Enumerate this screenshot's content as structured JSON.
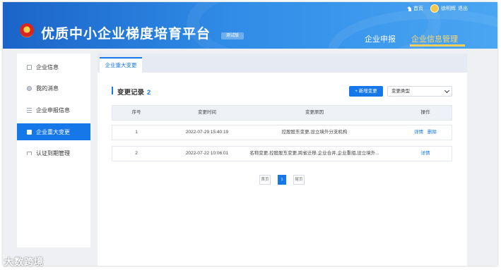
{
  "header": {
    "title": "优质中小企业梯度培育平台",
    "test_tag": "测试版",
    "home_label": "首页",
    "user_name": "徐明辉",
    "logout_label": "退出",
    "nav": [
      "企业申报",
      "企业信息管理"
    ],
    "active_nav": "企业信息管理"
  },
  "sidebar": {
    "items": [
      {
        "label": "企业信息",
        "icon": "document-icon"
      },
      {
        "label": "我的消息",
        "icon": "message-icon"
      },
      {
        "label": "企业申报信息",
        "icon": "list-icon"
      },
      {
        "label": "企业重大变更",
        "icon": "change-icon",
        "active": true
      },
      {
        "label": "认证到期管理",
        "icon": "flag-icon"
      }
    ]
  },
  "main": {
    "tab": "企业重大变更",
    "record_label": "变更记录",
    "record_count": "2",
    "add_button": "+ 新增变更",
    "select_value": "变更类型",
    "columns": [
      "序号",
      "变更时间",
      "变更原因",
      "操作"
    ],
    "rows": [
      {
        "index": "1",
        "time": "2022-07-29 15:40:19",
        "reason": "控股股东变更,设立境外分支机构",
        "actions": [
          "详情",
          "删除"
        ]
      },
      {
        "index": "2",
        "time": "2022-07-22 10:06:01",
        "reason": "名称变更,控股股东变更,跨省迁移,企业合并,企业重组,设立境外...",
        "actions": [
          "详情"
        ]
      }
    ],
    "pager": {
      "first": "首页",
      "current": "1",
      "last": "尾页"
    }
  },
  "watermark": "大数跨境",
  "colors": {
    "primary": "#1677e8",
    "header_start": "#1b64c8",
    "header_end": "#4aa6f2",
    "nav_active": "#ffd56b"
  }
}
